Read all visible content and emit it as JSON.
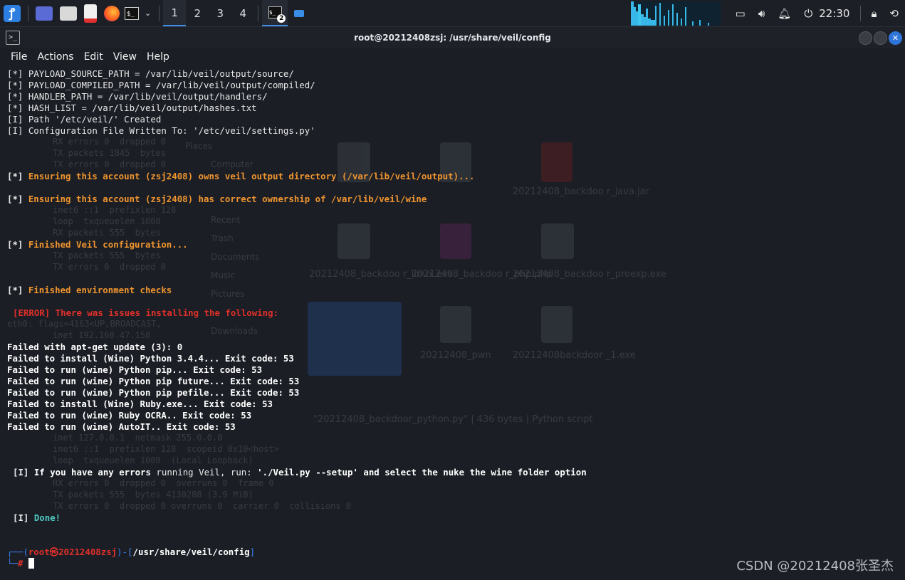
{
  "panel": {
    "workspaces": [
      "1",
      "2",
      "3",
      "4"
    ],
    "terminal_badge": "2",
    "clock": "22:30"
  },
  "window": {
    "title": "root@20212408zsj: /usr/share/veil/config",
    "menu": [
      "File",
      "Actions",
      "Edit",
      "View",
      "Help"
    ]
  },
  "terminal": {
    "lines": [
      {
        "bracket": "[*]",
        "text": " PAYLOAD_SOURCE_PATH = /var/lib/veil/output/source/"
      },
      {
        "bracket": "[*]",
        "text": " PAYLOAD_COMPILED_PATH = /var/lib/veil/output/compiled/"
      },
      {
        "bracket": "[*]",
        "text": " HANDLER_PATH = /var/lib/veil/output/handlers/"
      },
      {
        "bracket": "[*]",
        "text": " HASH_LIST = /var/lib/veil/output/hashes.txt"
      },
      {
        "bracket": "[I]",
        "text": " Path '/etc/veil/' Created"
      },
      {
        "bracket": "[I]",
        "text": " Configuration File Written To: '/etc/veil/settings.py'"
      }
    ],
    "msg_owns": "Ensuring this account (zsj2408) owns veil output directory (/var/lib/veil/output)...",
    "msg_ownership": "Ensuring this account (zsj2408) has correct ownership of /var/lib/veil/wine",
    "msg_finished_config": "Finished Veil configuration...",
    "msg_env": "Finished environment checks",
    "error_header": "[ERROR] There was issues installing the following:",
    "failures": [
      "Failed with apt-get update (3): 0",
      "Failed to install (Wine) Python 3.4.4... Exit code: 53",
      "Failed to run (wine) Python pip... Exit code: 53",
      "Failed to run (wine) Python pip future... Exit code: 53",
      "Failed to run (wine) Python pip pefile... Exit code: 53",
      "Failed to install (Wine) Ruby.exe... Exit code: 53",
      "Failed to run (wine) Ruby OCRA.. Exit code: 53",
      "Failed to run (wine) AutoIT.. Exit code: 53"
    ],
    "info_prefix": "If you have any errors",
    "info_mid": " running Veil, run: ",
    "info_cmd": "'./Veil.py --setup' and select the nuke the wine folder option",
    "done": "Done!",
    "prompt_user": "root㉿20212408zsj",
    "prompt_path": "/usr/share/veil/config",
    "prompt_symbol": "#"
  },
  "watermark": "CSDN @20212408张圣杰",
  "ghost": {
    "lines": [
      "RX errors 0  dropped 0",
      "TX packets 1845  bytes",
      "TX errors 0  dropped 0",
      "inet6 ::1  prefixlen 128",
      "loop  txqueuelen 1000",
      "RX packets 555  bytes",
      "TX packets 555  bytes",
      "TX errors 0  dropped 0",
      "eth0: flags=4163<UP,BROADCAST,",
      "inet 192.168.47.158",
      "inet 127.0.0.1  netmask 255.0.0.0",
      "inet6 ::1  prefixlen 128  scopeid 0x10<host>",
      "loop  txqueuelen 1000  (Local Loopback)",
      "RX errors 0  dropped 0  overruns 0  frame 0",
      "TX packets 555  bytes 4130288 (3.9 MiB)",
      "TX errors 0  dropped 0 overruns 0  carrier 0  collisions 0"
    ],
    "files": [
      "20212408_backdoo r_java.jar",
      "20212408_backdoo r_linux.exe",
      "20212408_backdoo r_php.php",
      "20212408_backdoo r_proexp.exe",
      "20212408_pwn",
      "20212408backdoor _1.exe"
    ],
    "places": [
      "Places",
      "Computer",
      "Recent",
      "Trash",
      "Documents",
      "Music",
      "Pictures",
      "Downloads"
    ],
    "status": "\"20212408_backdoor_python.py\" | 436 bytes | Python script"
  }
}
